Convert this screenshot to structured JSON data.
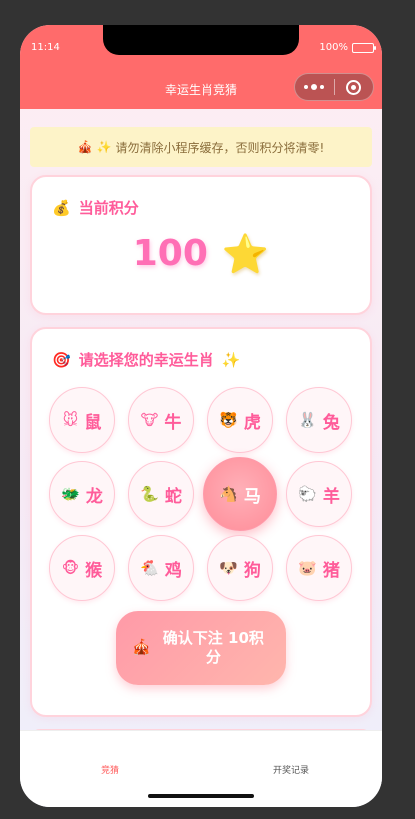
{
  "status_bar": {
    "time": "11:14",
    "battery": "100%"
  },
  "navbar": {
    "title": "幸运生肖竞猜"
  },
  "notice": {
    "icon": "🎪",
    "icon2": "✨",
    "text": "请勿清除小程序缓存，否则积分将清零!"
  },
  "points_card": {
    "icon": "💰",
    "title": "当前积分",
    "value": "100",
    "star": "⭐"
  },
  "select_card": {
    "icon": "🎯",
    "title": "请选择您的幸运生肖",
    "sparkle": "✨",
    "zodiacs": [
      {
        "emoji": "🐭",
        "label": "鼠"
      },
      {
        "emoji": "🐮",
        "label": "牛"
      },
      {
        "emoji": "🐯",
        "label": "虎"
      },
      {
        "emoji": "🐰",
        "label": "兔"
      },
      {
        "emoji": "🐲",
        "label": "龙"
      },
      {
        "emoji": "🐍",
        "label": "蛇"
      },
      {
        "emoji": "🐴",
        "label": "马"
      },
      {
        "emoji": "🐑",
        "label": "羊"
      },
      {
        "emoji": "🐵",
        "label": "猴"
      },
      {
        "emoji": "🐔",
        "label": "鸡"
      },
      {
        "emoji": "🐶",
        "label": "狗"
      },
      {
        "emoji": "🐷",
        "label": "猪"
      }
    ],
    "selected": "马",
    "confirm_icon": "🎪",
    "confirm_label": "确认下注 10积分"
  },
  "tabbar": {
    "tab1": "竞猜",
    "tab2": "开奖记录"
  },
  "colors": {
    "accent": "#ff6b6b",
    "pink": "#ff5c9a",
    "notice_bg": "#fdf3c8"
  }
}
